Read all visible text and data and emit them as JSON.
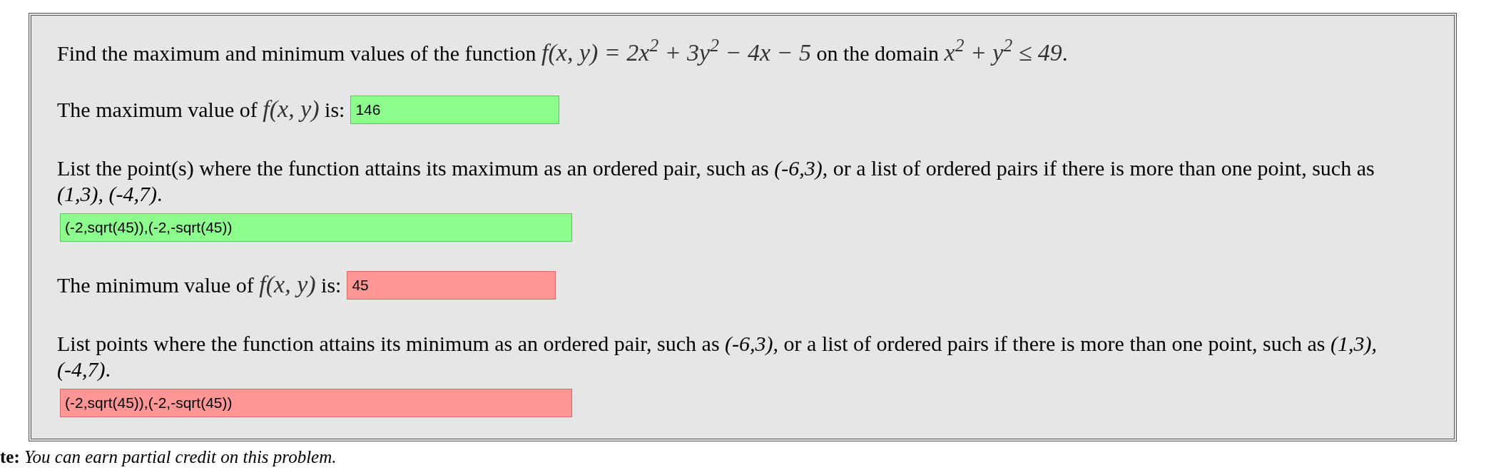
{
  "question": [
    {
      "kind": "text",
      "s": "Find the maximum and minimum values of the function "
    },
    {
      "kind": "math",
      "s": "f(x, y) = 2x$^{2}$ + 3y$^{2}$ − 4x − 5"
    },
    {
      "kind": "text",
      "s": " on the domain "
    },
    {
      "kind": "math",
      "s": "x$^{2}$ + y$^{2}$ ≤ 49"
    },
    {
      "kind": "text",
      "s": "."
    }
  ],
  "parts": [
    {
      "kind": "value",
      "label": [
        {
          "kind": "text",
          "s": "The maximum value of "
        },
        {
          "kind": "math",
          "s": "f(x, y)"
        },
        {
          "kind": "text",
          "s": " is:"
        }
      ],
      "answer": "146",
      "correct": true
    },
    {
      "kind": "points",
      "label": [
        {
          "kind": "text",
          "s": "List the point(s) where the function attains its maximum as an ordered pair, such as *(-6,3)*, or a list of ordered pairs if there is more than one point, such as *(1,3), (-4,7)*."
        }
      ],
      "answer": "(-2,sqrt(45)),(-2,-sqrt(45))",
      "correct": true
    },
    {
      "kind": "value",
      "label": [
        {
          "kind": "text",
          "s": "The minimum value of "
        },
        {
          "kind": "math",
          "s": "f(x, y)"
        },
        {
          "kind": "text",
          "s": " is:"
        }
      ],
      "answer": "45",
      "correct": false
    },
    {
      "kind": "points",
      "label": [
        {
          "kind": "text",
          "s": "List points where the function attains its minimum as an ordered pair, such as *(-6,3)*, or a list of ordered pairs if there is more than one point, such as *(1,3), (-4,7)*."
        }
      ],
      "answer": "(-2,sqrt(45)),(-2,-sqrt(45))",
      "correct": false
    }
  ],
  "note": "**te:** *You can earn partial credit on this problem.*"
}
